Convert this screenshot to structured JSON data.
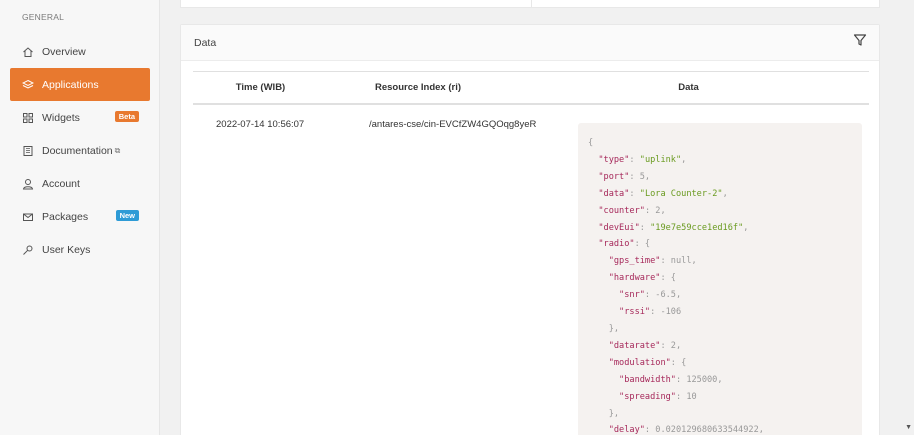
{
  "sidebar": {
    "section_title": "GENERAL",
    "items": [
      {
        "label": "Overview"
      },
      {
        "label": "Applications"
      },
      {
        "label": "Widgets",
        "badge": "Beta"
      },
      {
        "label": "Documentation",
        "ext": "⧉"
      },
      {
        "label": "Account"
      },
      {
        "label": "Packages",
        "badge": "New"
      },
      {
        "label": "User Keys"
      }
    ]
  },
  "card": {
    "title": "Data"
  },
  "table": {
    "columns": [
      "Time (WIB)",
      "Resource Index (ri)",
      "Data"
    ],
    "rows": [
      {
        "time": "2022-07-14 10:56:07",
        "ri": "/antares-cse/cin-EVCfZW4GQOqg8yeR"
      }
    ]
  },
  "json_lines": [
    [
      [
        "p",
        "{"
      ]
    ],
    [
      [
        "p",
        "  "
      ],
      [
        "k",
        "\"type\""
      ],
      [
        "p",
        ": "
      ],
      [
        "s",
        "\"uplink\""
      ],
      [
        "p",
        ","
      ]
    ],
    [
      [
        "p",
        "  "
      ],
      [
        "k",
        "\"port\""
      ],
      [
        "p",
        ": 5,"
      ]
    ],
    [
      [
        "p",
        "  "
      ],
      [
        "k",
        "\"data\""
      ],
      [
        "p",
        ": "
      ],
      [
        "s",
        "\"Lora Counter-2\""
      ],
      [
        "p",
        ","
      ]
    ],
    [
      [
        "p",
        "  "
      ],
      [
        "k",
        "\"counter\""
      ],
      [
        "p",
        ": 2,"
      ]
    ],
    [
      [
        "p",
        "  "
      ],
      [
        "k",
        "\"devEui\""
      ],
      [
        "p",
        ": "
      ],
      [
        "s",
        "\"19e7e59cce1ed16f\""
      ],
      [
        "p",
        ","
      ]
    ],
    [
      [
        "p",
        "  "
      ],
      [
        "k",
        "\"radio\""
      ],
      [
        "p",
        ": {"
      ]
    ],
    [
      [
        "p",
        "    "
      ],
      [
        "k",
        "\"gps_time\""
      ],
      [
        "p",
        ": null,"
      ]
    ],
    [
      [
        "p",
        "    "
      ],
      [
        "k",
        "\"hardware\""
      ],
      [
        "p",
        ": {"
      ]
    ],
    [
      [
        "p",
        "      "
      ],
      [
        "k",
        "\"snr\""
      ],
      [
        "p",
        ": -6.5,"
      ]
    ],
    [
      [
        "p",
        "      "
      ],
      [
        "k",
        "\"rssi\""
      ],
      [
        "p",
        ": -106"
      ]
    ],
    [
      [
        "p",
        "    },"
      ]
    ],
    [
      [
        "p",
        "    "
      ],
      [
        "k",
        "\"datarate\""
      ],
      [
        "p",
        ": 2,"
      ]
    ],
    [
      [
        "p",
        "    "
      ],
      [
        "k",
        "\"modulation\""
      ],
      [
        "p",
        ": {"
      ]
    ],
    [
      [
        "p",
        "      "
      ],
      [
        "k",
        "\"bandwidth\""
      ],
      [
        "p",
        ": 125000,"
      ]
    ],
    [
      [
        "p",
        "      "
      ],
      [
        "k",
        "\"spreading\""
      ],
      [
        "p",
        ": 10"
      ]
    ],
    [
      [
        "p",
        "    },"
      ]
    ],
    [
      [
        "p",
        "    "
      ],
      [
        "k",
        "\"delay\""
      ],
      [
        "p",
        ": 0.020129680633544922,"
      ]
    ]
  ]
}
